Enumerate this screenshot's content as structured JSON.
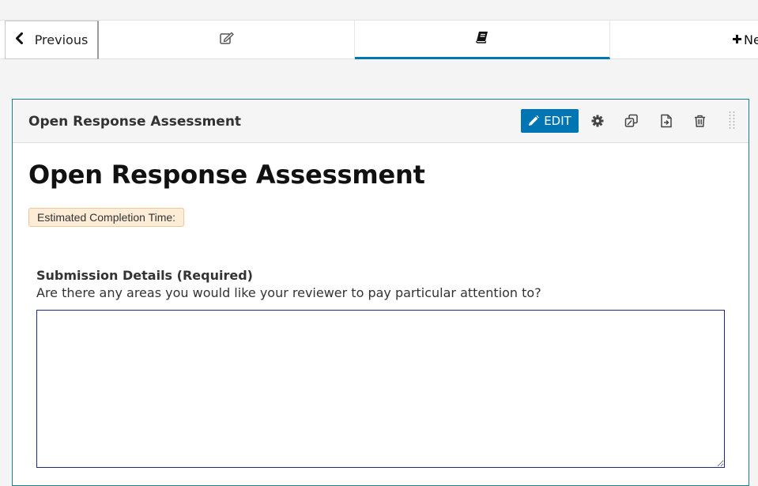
{
  "nav": {
    "previous_label": "Previous",
    "next_label": "Ne",
    "tabs": [
      {
        "icon": "edit-icon"
      },
      {
        "icon": "book-icon",
        "active": true
      },
      {
        "icon": "plus-icon"
      }
    ]
  },
  "xblock": {
    "header_title": "Open Response Assessment",
    "edit_label": "EDIT",
    "actions": [
      "gear-icon",
      "duplicate-icon",
      "move-icon",
      "delete-icon",
      "drag-handle-icon"
    ]
  },
  "content": {
    "heading": "Open Response Assessment",
    "estimated_time_label": "Estimated Completion Time:",
    "submission_label": "Submission Details (Required)",
    "submission_prompt": "Are there any areas you would like your reviewer to pay particular attention to?",
    "submission_value": ""
  },
  "colors": {
    "accent": "#0075b4",
    "card_border": "#1d7f8c",
    "badge_bg": "#fdecd6"
  }
}
